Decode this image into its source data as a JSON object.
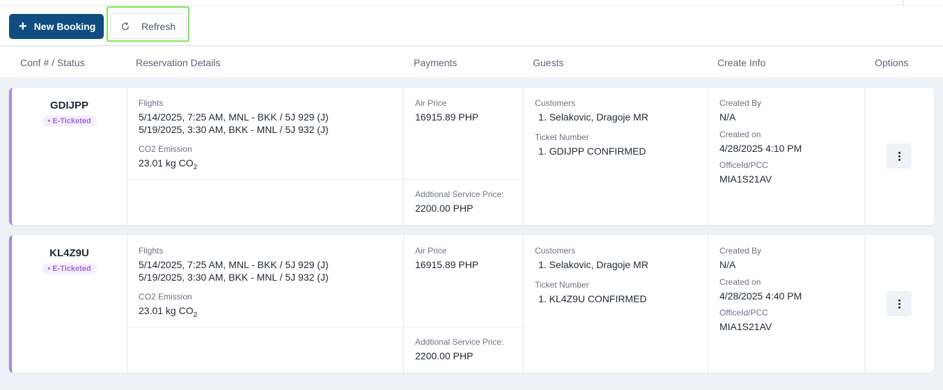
{
  "toolbar": {
    "new_booking_label": "New Booking",
    "refresh_label": "Refresh"
  },
  "table": {
    "headers": [
      "Conf # / Status",
      "Reservation Details",
      "Payments",
      "Guests",
      "Create Info",
      "Options"
    ]
  },
  "labels": {
    "flights": "Flights",
    "co2": "CO2 Emission",
    "air_price": "Air Price",
    "additional_price": "Addtional Service Price:",
    "customers": "Customers",
    "ticket_number": "Ticket Number",
    "created_by": "Created By",
    "created_on": "Created on",
    "office": "OfficeId/PCC"
  },
  "colors": {
    "primary": "#0f4c81",
    "accent_border": "#a78bdb",
    "badge_text": "#a36ad8",
    "highlight": "#7be35a"
  },
  "bookings": [
    {
      "conf": "GDIJPP",
      "status": "• E-Ticketed",
      "flights": [
        "5/14/2025, 7:25 AM, MNL - BKK / 5J 929 (J)",
        "5/19/2025, 3:30 AM, BKK - MNL / 5J 932 (J)"
      ],
      "co2_value": "23.01 kg CO",
      "co2_sub": "2",
      "air_price": "16915.89 PHP",
      "additional_price": "2200.00 PHP",
      "customer": "1. Selakovic, Dragoje MR",
      "ticket": "1. GDIJPP CONFIRMED",
      "created_by": "N/A",
      "created_on": "4/28/2025 4:10 PM",
      "office": "MIA1S21AV"
    },
    {
      "conf": "KL4Z9U",
      "status": "• E-Ticketed",
      "flights": [
        "5/14/2025, 7:25 AM, MNL - BKK / 5J 929 (J)",
        "5/19/2025, 3:30 AM, BKK - MNL / 5J 932 (J)"
      ],
      "co2_value": "23.01 kg CO",
      "co2_sub": "2",
      "air_price": "16915.89 PHP",
      "additional_price": "2200.00 PHP",
      "customer": "1. Selakovic, Dragoje MR",
      "ticket": "1. KL4Z9U CONFIRMED",
      "created_by": "N/A",
      "created_on": "4/28/2025 4:40 PM",
      "office": "MIA1S21AV"
    }
  ]
}
